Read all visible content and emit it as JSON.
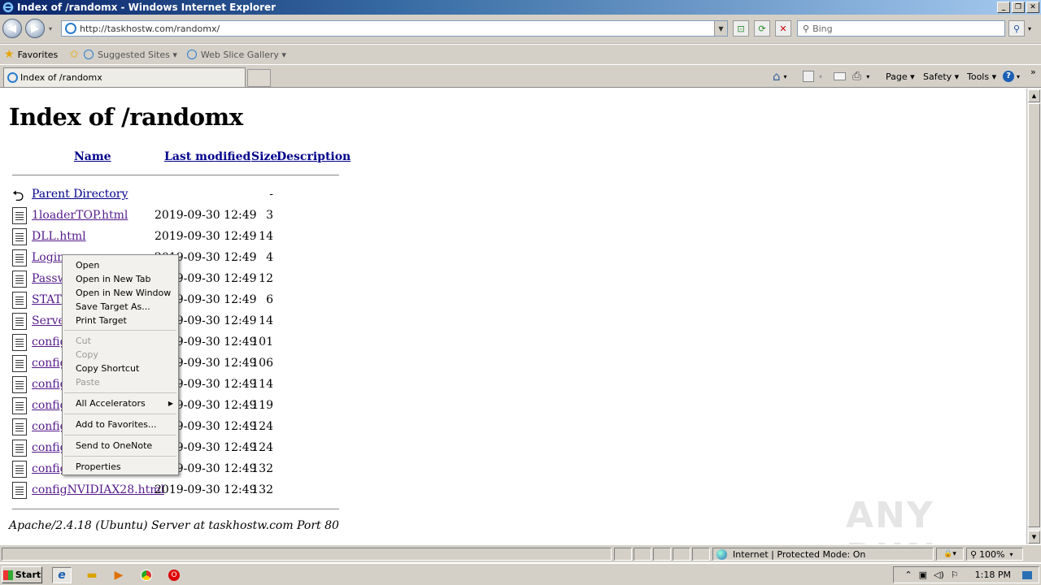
{
  "window": {
    "title": "Index of /randomx - Windows Internet Explorer"
  },
  "address": {
    "url": "http://taskhostw.com/randomx/",
    "search_placeholder": "Bing"
  },
  "favorites": {
    "label": "Favorites",
    "items": [
      "Suggested Sites ▾",
      "Web Slice Gallery ▾"
    ]
  },
  "tab": {
    "title": "Index of /randomx"
  },
  "commandbar": {
    "page": "Page ▾",
    "safety": "Safety ▾",
    "tools": "Tools ▾"
  },
  "page": {
    "heading": "Index of /randomx",
    "columns": {
      "name": "Name",
      "modified": "Last modified",
      "size": "Size",
      "description": "Description"
    },
    "rows": [
      {
        "name": "Parent Directory",
        "date": "",
        "size": "-"
      },
      {
        "name": "1loaderTOP.html",
        "date": "2019-09-30 12:49",
        "size": "3"
      },
      {
        "name": "DLL.html",
        "date": "2019-09-30 12:49",
        "size": "14"
      },
      {
        "name": "Login.",
        "date": "2019-09-30 12:49",
        "size": "4"
      },
      {
        "name": "Passw",
        "date": "2019-09-30 12:49",
        "size": "12"
      },
      {
        "name": "STAT",
        "date": "2019-09-30 12:49",
        "size": "6"
      },
      {
        "name": "Serve",
        "date": "2019-09-30 12:49",
        "size": "14"
      },
      {
        "name": "config",
        "date": "2019-09-30 12:49",
        "size": "101"
      },
      {
        "name": "config",
        "date": "2019-09-30 12:49",
        "size": "106"
      },
      {
        "name": "config",
        "date": "2019-09-30 12:49",
        "size": "114"
      },
      {
        "name": "config",
        "date": "2019-09-30 12:49",
        "size": "119"
      },
      {
        "name": "config",
        "date": "2019-09-30 12:49",
        "size": "124"
      },
      {
        "name": "config",
        "date": "2019-09-30 12:49",
        "size": "124"
      },
      {
        "name": "config",
        "date": "2019-09-30 12:49",
        "size": "132"
      },
      {
        "name": "configNVIDIAX28.html",
        "date": "2019-09-30 12:49",
        "size": "132"
      }
    ],
    "footer": "Apache/2.4.18 (Ubuntu) Server at taskhostw.com Port 80"
  },
  "context_menu": {
    "open": "Open",
    "open_new_tab": "Open in New Tab",
    "open_new_window": "Open in New Window",
    "save_target": "Save Target As...",
    "print_target": "Print Target",
    "cut": "Cut",
    "copy": "Copy",
    "copy_shortcut": "Copy Shortcut",
    "paste": "Paste",
    "all_accelerators": "All Accelerators",
    "add_favorites": "Add to Favorites...",
    "send_onenote": "Send to OneNote",
    "properties": "Properties"
  },
  "status": {
    "zone": "Internet | Protected Mode: On",
    "zoom": "100%"
  },
  "taskbar": {
    "start": "Start",
    "time": "1:18 PM"
  },
  "watermark": "ANY RUN"
}
